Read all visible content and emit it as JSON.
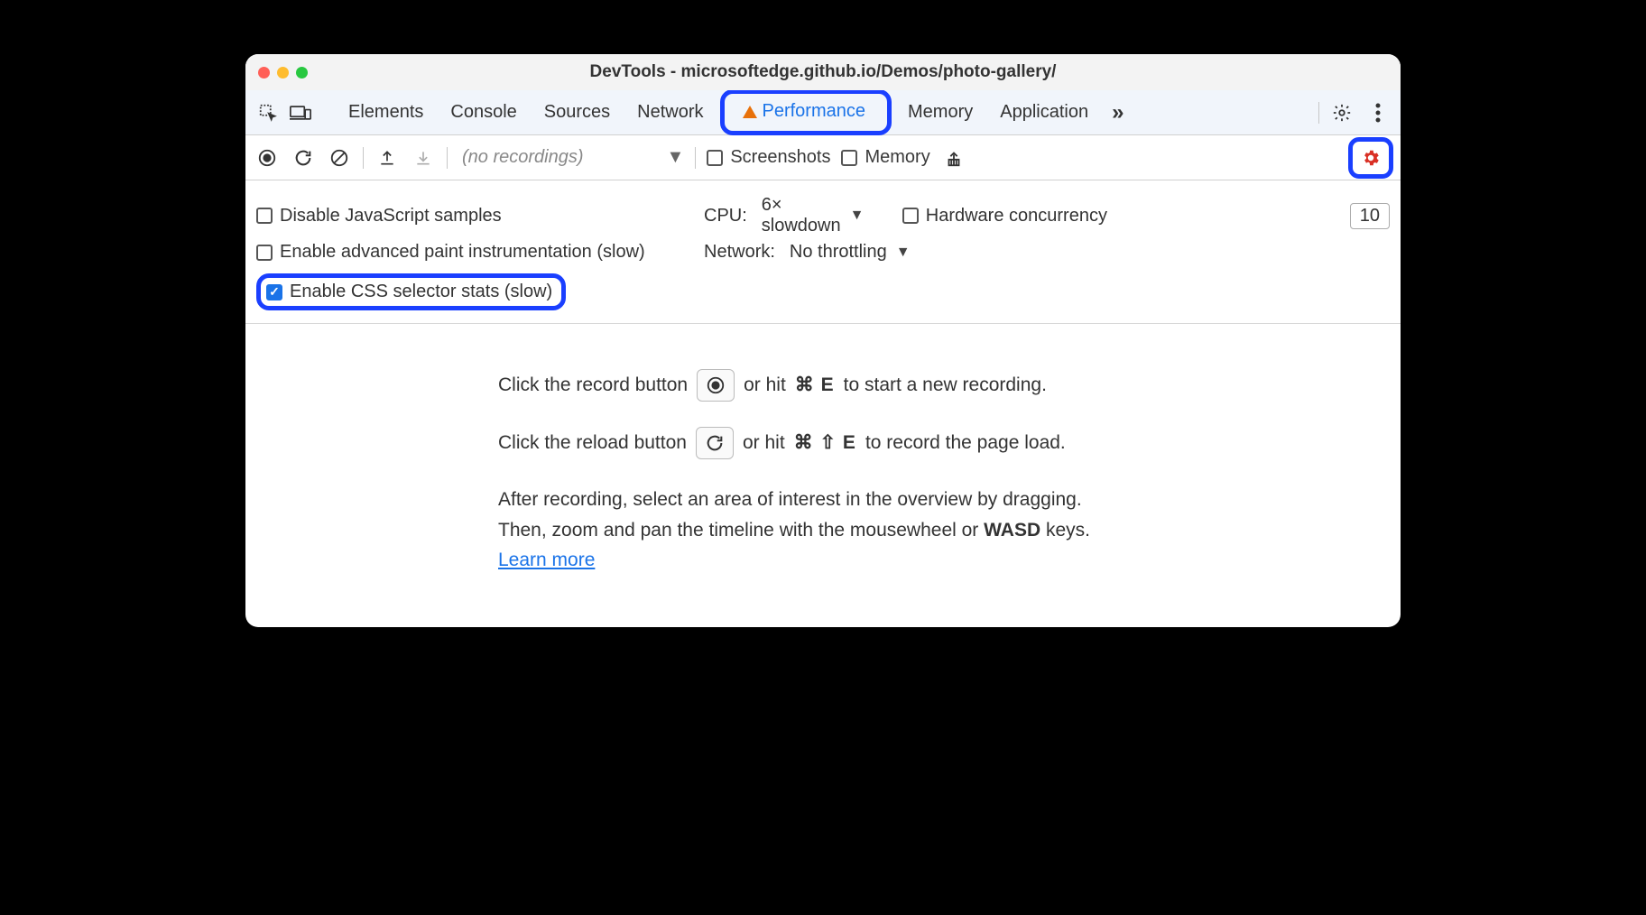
{
  "window": {
    "title": "DevTools - microsoftedge.github.io/Demos/photo-gallery/"
  },
  "tabs": {
    "items": [
      "Elements",
      "Console",
      "Sources",
      "Network",
      "Performance",
      "Memory",
      "Application"
    ],
    "active": "Performance",
    "overflow_glyph": "»"
  },
  "toolbar": {
    "no_recordings": "(no recordings)",
    "screenshots_label": "Screenshots",
    "memory_label": "Memory"
  },
  "settings": {
    "disable_js_samples": "Disable JavaScript samples",
    "enable_paint_instr": "Enable advanced paint instrumentation (slow)",
    "enable_css_stats": "Enable CSS selector stats (slow)",
    "cpu_label": "CPU:",
    "cpu_value": "6× slowdown",
    "network_label": "Network:",
    "network_value": "No throttling",
    "hw_concurrency_label": "Hardware concurrency",
    "hw_concurrency_value": "10"
  },
  "content": {
    "line1_a": "Click the record button",
    "line1_b_orhit": "or hit",
    "line1_kbd": "⌘ E",
    "line1_c": "to start a new recording.",
    "line2_a": "Click the reload button",
    "line2_b_orhit": "or hit",
    "line2_kbd": "⌘ ⇧ E",
    "line2_c": "to record the page load.",
    "para1": "After recording, select an area of interest in the overview by dragging.",
    "para2_a": "Then, zoom and pan the timeline with the mousewheel or ",
    "para2_wasd": "WASD",
    "para2_b": " keys.",
    "learn_more": "Learn more"
  }
}
